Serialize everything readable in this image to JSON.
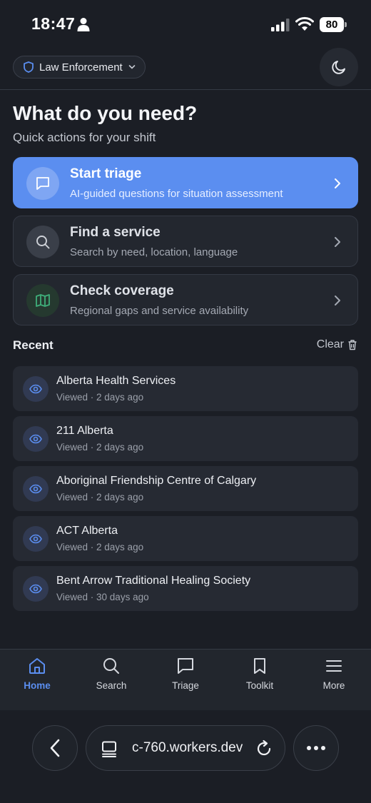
{
  "status_bar": {
    "time": "18:47",
    "battery": "80"
  },
  "header": {
    "role_label": "Law Enforcement"
  },
  "page": {
    "title": "What do you need?",
    "subtitle": "Quick actions for your shift"
  },
  "actions": [
    {
      "title": "Start triage",
      "desc": "AI-guided questions for situation assessment",
      "icon": "chat-bubble-icon"
    },
    {
      "title": "Find a service",
      "desc": "Search by need, location, language",
      "icon": "search-icon"
    },
    {
      "title": "Check coverage",
      "desc": "Regional gaps and service availability",
      "icon": "map-icon"
    }
  ],
  "recent": {
    "heading": "Recent",
    "clear_label": "Clear",
    "items": [
      {
        "name": "Alberta Health Services",
        "meta": "Viewed · 2 days ago"
      },
      {
        "name": "211 Alberta",
        "meta": "Viewed · 2 days ago"
      },
      {
        "name": "Aboriginal Friendship Centre of Calgary",
        "meta": "Viewed · 2 days ago"
      },
      {
        "name": "ACT Alberta",
        "meta": "Viewed · 2 days ago"
      },
      {
        "name": "Bent Arrow Traditional Healing Society",
        "meta": "Viewed · 30 days ago"
      }
    ]
  },
  "tabs": [
    {
      "label": "Home",
      "icon": "home-icon",
      "active": true
    },
    {
      "label": "Search",
      "icon": "search-icon"
    },
    {
      "label": "Triage",
      "icon": "chat-bubble-icon"
    },
    {
      "label": "Toolkit",
      "icon": "bookmark-icon"
    },
    {
      "label": "More",
      "icon": "menu-icon"
    }
  ],
  "browser": {
    "url": "c-760.workers.dev"
  },
  "colors": {
    "accent": "#5b8ef0",
    "background": "#1b1e25",
    "card": "#23272f"
  }
}
